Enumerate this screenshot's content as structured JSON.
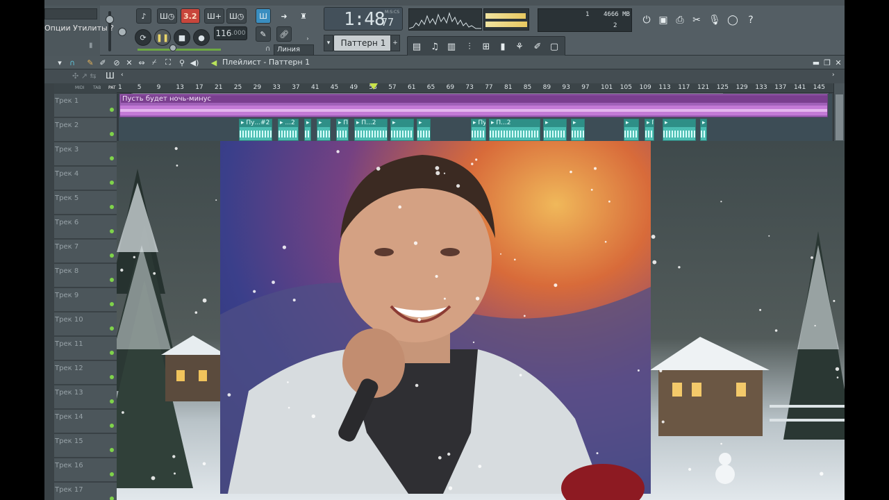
{
  "menu": {
    "options_label": "Опции Утилиты ?"
  },
  "transport": {
    "bpm": "116",
    "bpm_decimal": ".000",
    "time_main": "1:48",
    "time_small": "77",
    "time_label": "M:S:CS",
    "time_sig_badge": "3.2",
    "snap_label": "Линия",
    "pattern": "Паттерн 1"
  },
  "info": {
    "cpu": "1",
    "memory": "4666 MB",
    "voices": "2"
  },
  "playlist": {
    "title": "Плейлист - Паттерн 1",
    "ruler": [
      "1",
      "5",
      "9",
      "13",
      "17",
      "21",
      "25",
      "29",
      "33",
      "37",
      "41",
      "45",
      "49",
      "53",
      "57",
      "61",
      "65",
      "69",
      "73",
      "77",
      "81",
      "85",
      "89",
      "93",
      "97",
      "101",
      "105",
      "109",
      "113",
      "117",
      "121",
      "125",
      "129",
      "133",
      "137",
      "141",
      "145"
    ],
    "mini_labels": [
      "MIDI",
      "TAB",
      "PAT"
    ],
    "tracks": [
      "Трек 1",
      "Трек 2",
      "Трек 3",
      "Трек 4",
      "Трек 5",
      "Трек 6",
      "Трек 7",
      "Трек 8",
      "Трек 9",
      "Трек 10",
      "Трек 11",
      "Трек 12",
      "Трек 13",
      "Трек 14",
      "Трек 15",
      "Трек 16",
      "Трек 17"
    ],
    "clip_main": "Пусть будет ночь-минус",
    "clips_track2": [
      "Пу...#2",
      "...2",
      "",
      "",
      "Пу...#2",
      "П...2",
      "",
      "",
      "Пусть...als] #2",
      "П...2",
      "",
      "",
      "",
      "Пу...#2",
      "",
      ""
    ],
    "colors": {
      "audio_clip": "#a061b8",
      "vocal_clip": "#4bbdb2",
      "track_led": "#7fd34a"
    }
  }
}
